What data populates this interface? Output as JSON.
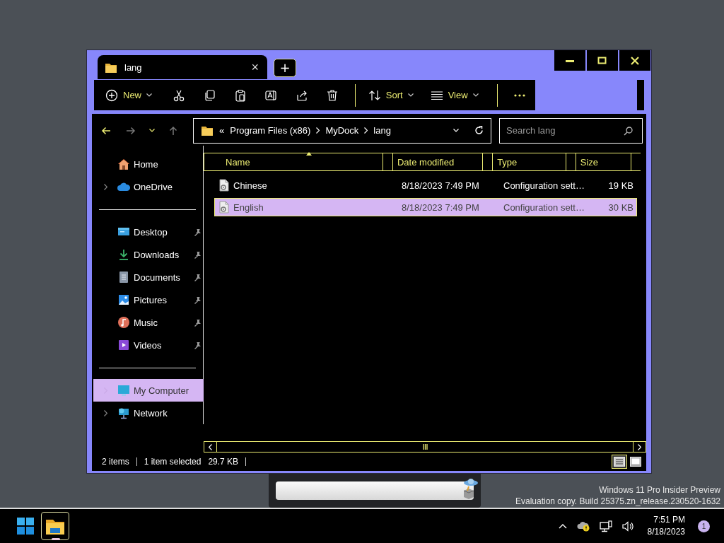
{
  "tab": {
    "title": "lang",
    "close": "×"
  },
  "new_tab": "+",
  "toolbar": [
    {
      "kind": "new",
      "label": "New"
    },
    {
      "kind": "cut"
    },
    {
      "kind": "copy"
    },
    {
      "kind": "paste"
    },
    {
      "kind": "rename"
    },
    {
      "kind": "share"
    },
    {
      "kind": "delete"
    },
    {
      "kind": "separator"
    },
    {
      "kind": "sort",
      "label": "Sort"
    },
    {
      "kind": "view",
      "label": "View"
    },
    {
      "kind": "separator"
    },
    {
      "kind": "more"
    }
  ],
  "navigation": {
    "back_enabled": true,
    "forward_enabled": false,
    "up_enabled": false
  },
  "address_bar": {
    "overflow": "«",
    "segments": [
      "Program Files (x86)",
      "MyDock",
      "lang"
    ]
  },
  "search": {
    "placeholder": "Search lang"
  },
  "sidebar": [
    {
      "items": [
        {
          "kind": "home",
          "label": "Home",
          "expandable": false,
          "pinned": false,
          "selected": false
        },
        {
          "kind": "cloud",
          "label": "OneDrive",
          "expandable": true,
          "pinned": false,
          "selected": false
        }
      ]
    },
    {
      "items": [
        {
          "kind": "desktop",
          "label": "Desktop",
          "expandable": false,
          "pinned": true,
          "selected": false
        },
        {
          "kind": "downloads",
          "label": "Downloads",
          "expandable": false,
          "pinned": true,
          "selected": false
        },
        {
          "kind": "documents",
          "label": "Documents",
          "expandable": false,
          "pinned": true,
          "selected": false
        },
        {
          "kind": "pictures",
          "label": "Pictures",
          "expandable": false,
          "pinned": true,
          "selected": false
        },
        {
          "kind": "music",
          "label": "Music",
          "expandable": false,
          "pinned": true,
          "selected": false
        },
        {
          "kind": "videos",
          "label": "Videos",
          "expandable": false,
          "pinned": true,
          "selected": false
        }
      ]
    },
    {
      "items": [
        {
          "kind": "computer",
          "label": "My Computer",
          "expandable": true,
          "pinned": false,
          "selected": true
        },
        {
          "kind": "network",
          "label": "Network",
          "expandable": true,
          "pinned": false,
          "selected": false
        }
      ]
    }
  ],
  "columns": [
    {
      "label": "Name",
      "sorted": true
    },
    {
      "label": "Date modified",
      "sorted": false
    },
    {
      "label": "Type",
      "sorted": false
    },
    {
      "label": "Size",
      "sorted": false
    }
  ],
  "files": [
    {
      "name": "Chinese",
      "date_modified": "8/18/2023 7:49 PM",
      "type": "Configuration sett…",
      "size": "19 KB",
      "selected": false
    },
    {
      "name": "English",
      "date_modified": "8/18/2023 7:49 PM",
      "type": "Configuration sett…",
      "size": "30 KB",
      "selected": true
    }
  ],
  "status_bar": {
    "item_count": "2 items",
    "selection": "1 item selected",
    "selection_size": "29.7 KB"
  },
  "view_modes": [
    {
      "kind": "details",
      "selected": true
    },
    {
      "kind": "tiles",
      "selected": false
    }
  ],
  "desktop": {
    "edition": "Windows 11 Pro Insider Preview",
    "build": "Evaluation copy. Build 25375.zn_release.230520-1632"
  },
  "taskbar": {
    "apps": [
      {
        "kind": "start",
        "selected": false
      },
      {
        "kind": "explorer",
        "selected": true
      }
    ],
    "time": "7:51 PM",
    "date": "8/18/2023",
    "notifications": "1"
  }
}
